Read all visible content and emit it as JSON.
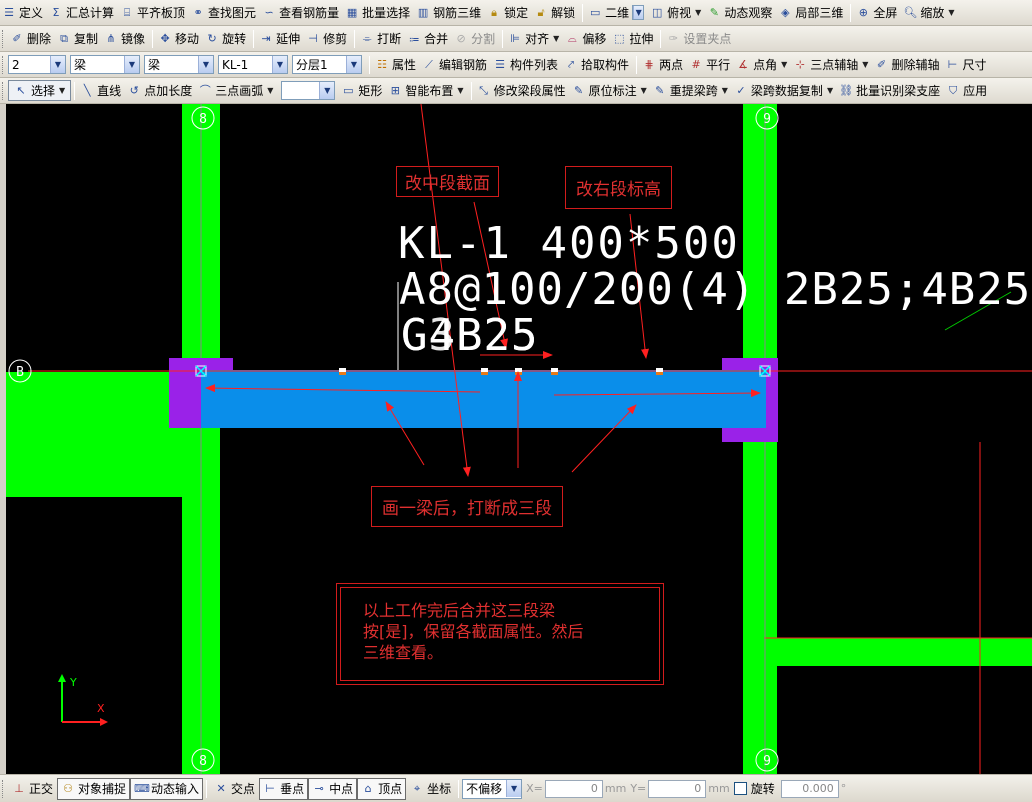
{
  "toolbar1": {
    "items": [
      {
        "label": "定义",
        "icon": "define-icon"
      },
      {
        "label": "汇总计算",
        "icon": "sigma-icon"
      },
      {
        "label": "平齐板顶",
        "icon": "align-slab-top-icon"
      },
      {
        "label": "查找图元",
        "icon": "binoculars-icon"
      },
      {
        "label": "查看钢筋量",
        "icon": "rebar-quantity-icon"
      },
      {
        "label": "批量选择",
        "icon": "batch-select-icon"
      },
      {
        "label": "钢筋三维",
        "icon": "rebar-3d-icon"
      },
      {
        "label": "锁定",
        "icon": "lock-icon"
      },
      {
        "label": "解锁",
        "icon": "unlock-icon"
      }
    ],
    "view_mode": "二维",
    "view_items": [
      {
        "label": "俯视",
        "icon": "top-view-icon"
      },
      {
        "label": "动态观察",
        "icon": "orbit-icon"
      },
      {
        "label": "局部三维",
        "icon": "local-3d-icon"
      },
      {
        "label": "全屏",
        "icon": "fullscreen-icon"
      },
      {
        "label": "缩放",
        "icon": "zoom-icon"
      }
    ]
  },
  "toolbar2": {
    "items": [
      {
        "label": "删除",
        "icon": "delete-icon",
        "enabled": true
      },
      {
        "label": "复制",
        "icon": "copy-icon",
        "enabled": true
      },
      {
        "label": "镜像",
        "icon": "mirror-icon",
        "enabled": true
      },
      {
        "label": "移动",
        "icon": "move-icon",
        "enabled": true
      },
      {
        "label": "旋转",
        "icon": "rotate-icon",
        "enabled": true
      },
      {
        "label": "延伸",
        "icon": "extend-icon",
        "enabled": true
      },
      {
        "label": "修剪",
        "icon": "trim-icon",
        "enabled": true
      },
      {
        "label": "打断",
        "icon": "break-icon",
        "enabled": true
      },
      {
        "label": "合并",
        "icon": "merge-icon",
        "enabled": true
      },
      {
        "label": "分割",
        "icon": "split-icon",
        "enabled": false
      },
      {
        "label": "对齐",
        "icon": "align-icon",
        "enabled": true
      },
      {
        "label": "偏移",
        "icon": "offset-icon",
        "enabled": true
      },
      {
        "label": "拉伸",
        "icon": "stretch-icon",
        "enabled": true
      },
      {
        "label": "设置夹点",
        "icon": "grip-point-icon",
        "enabled": false
      }
    ]
  },
  "toolbar3": {
    "selects": [
      "2",
      "梁",
      "梁",
      "KL-1",
      "分层1"
    ],
    "items": [
      {
        "label": "属性",
        "icon": "properties-icon"
      },
      {
        "label": "编辑钢筋",
        "icon": "edit-rebar-icon"
      },
      {
        "label": "构件列表",
        "icon": "component-list-icon"
      },
      {
        "label": "拾取构件",
        "icon": "pick-component-icon"
      },
      {
        "label": "两点",
        "icon": "two-point-axis-icon"
      },
      {
        "label": "平行",
        "icon": "parallel-axis-icon"
      },
      {
        "label": "点角",
        "icon": "point-angle-icon"
      },
      {
        "label": "三点辅轴",
        "icon": "three-point-axis-icon"
      },
      {
        "label": "删除辅轴",
        "icon": "delete-axis-icon"
      },
      {
        "label": "尺寸",
        "icon": "dimension-icon"
      }
    ]
  },
  "toolbar4": {
    "select_label": "选择",
    "blank_select": "",
    "items": [
      {
        "label": "直线",
        "icon": "line-icon"
      },
      {
        "label": "点加长度",
        "icon": "point-length-icon"
      },
      {
        "label": "三点画弧",
        "icon": "arc-icon"
      },
      {
        "label": "矩形",
        "icon": "rectangle-icon"
      },
      {
        "label": "智能布置",
        "icon": "smart-layout-icon"
      },
      {
        "label": "修改梁段属性",
        "icon": "edit-segment-icon"
      },
      {
        "label": "原位标注",
        "icon": "in-situ-label-icon"
      },
      {
        "label": "重提梁跨",
        "icon": "span-icon"
      },
      {
        "label": "梁跨数据复制",
        "icon": "span-copy-icon"
      },
      {
        "label": "批量识别梁支座",
        "icon": "batch-support-icon"
      },
      {
        "label": "应用",
        "icon": "apply-icon"
      }
    ]
  },
  "canvas": {
    "grid_labels": {
      "top_left": "8",
      "top_right": "9",
      "left": "B",
      "bottom_left": "8",
      "bottom_right": "9"
    },
    "beam_text": {
      "line1": "KL-1 400*500",
      "line2": "A8@100/200(4) 2B25;4B25",
      "line3a": "G4B25",
      "line3b": "G3B25"
    },
    "annotations": {
      "middle_section": "改中段截面",
      "right_elevation": "改右段标高",
      "break_note": "画一梁后，打断成三段",
      "merge_note": "以上工作完后合并这三段梁\n按[是]，保留各截面属性。然后\n三维查看。"
    },
    "axis": {
      "x": "X",
      "y": "Y"
    },
    "colors": {
      "column": "#00ff00",
      "beam": "#0a8eea",
      "support": "#9a22e8",
      "annotation": "#e02020",
      "background": "#000000"
    }
  },
  "statusbar": {
    "items": [
      {
        "label": "正交",
        "icon": "ortho-icon",
        "boxed": false
      },
      {
        "label": "对象捕捉",
        "icon": "osnap-icon",
        "boxed": true
      },
      {
        "label": "动态输入",
        "icon": "dynamic-input-icon",
        "boxed": true
      },
      {
        "label": "交点",
        "icon": "intersection-icon",
        "boxed": false
      },
      {
        "label": "垂点",
        "icon": "perpendicular-icon",
        "boxed": true
      },
      {
        "label": "中点",
        "icon": "midpoint-icon",
        "boxed": true
      },
      {
        "label": "顶点",
        "icon": "vertex-icon",
        "boxed": true
      },
      {
        "label": "坐标",
        "icon": "coordinate-icon",
        "boxed": false
      }
    ],
    "offset_mode": "不偏移",
    "x_label": "X=",
    "x_value": "0",
    "y_label": "Y=",
    "y_value": "0",
    "unit": "mm",
    "rotate_label": "旋转",
    "rotate_value": "0.000",
    "degree": "°"
  }
}
